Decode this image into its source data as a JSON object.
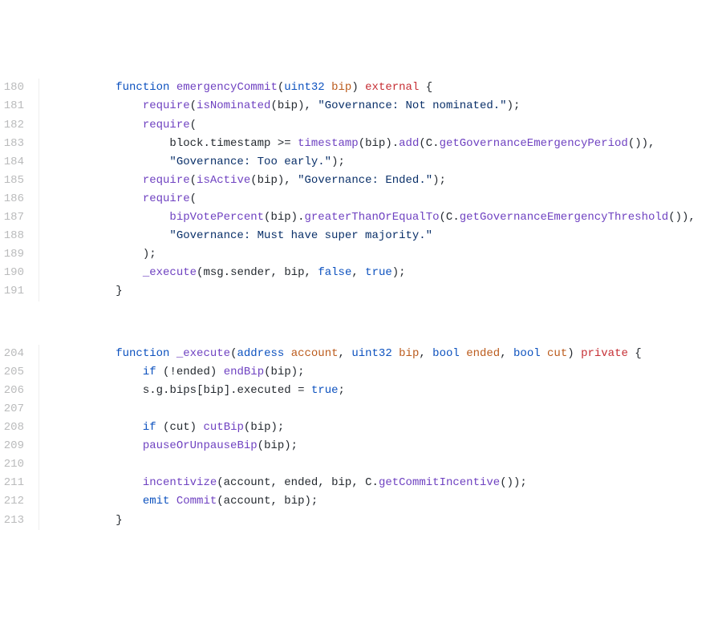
{
  "code": {
    "block1": {
      "lines": [
        {
          "n": "180",
          "indent": 2,
          "tokens": [
            {
              "cls": "kw",
              "t": "function"
            },
            {
              "cls": "plain",
              "t": " "
            },
            {
              "cls": "fn",
              "t": "emergencyCommit"
            },
            {
              "cls": "punct",
              "t": "("
            },
            {
              "cls": "type",
              "t": "uint32"
            },
            {
              "cls": "plain",
              "t": " "
            },
            {
              "cls": "param",
              "t": "bip"
            },
            {
              "cls": "punct",
              "t": ")"
            },
            {
              "cls": "plain",
              "t": " "
            },
            {
              "cls": "mod",
              "t": "external"
            },
            {
              "cls": "plain",
              "t": " "
            },
            {
              "cls": "punct",
              "t": "{"
            }
          ]
        },
        {
          "n": "181",
          "indent": 3,
          "tokens": [
            {
              "cls": "fn",
              "t": "require"
            },
            {
              "cls": "punct",
              "t": "("
            },
            {
              "cls": "fn",
              "t": "isNominated"
            },
            {
              "cls": "punct",
              "t": "("
            },
            {
              "cls": "plain",
              "t": "bip"
            },
            {
              "cls": "punct",
              "t": "), "
            },
            {
              "cls": "str",
              "t": "\"Governance: Not nominated.\""
            },
            {
              "cls": "punct",
              "t": ");"
            }
          ]
        },
        {
          "n": "182",
          "indent": 3,
          "tokens": [
            {
              "cls": "fn",
              "t": "require"
            },
            {
              "cls": "punct",
              "t": "("
            }
          ]
        },
        {
          "n": "183",
          "indent": 4,
          "tokens": [
            {
              "cls": "plain",
              "t": "block"
            },
            {
              "cls": "punct",
              "t": "."
            },
            {
              "cls": "plain",
              "t": "timestamp "
            },
            {
              "cls": "punct",
              "t": ">="
            },
            {
              "cls": "plain",
              "t": " "
            },
            {
              "cls": "fn",
              "t": "timestamp"
            },
            {
              "cls": "punct",
              "t": "("
            },
            {
              "cls": "plain",
              "t": "bip"
            },
            {
              "cls": "punct",
              "t": ")."
            },
            {
              "cls": "fn",
              "t": "add"
            },
            {
              "cls": "punct",
              "t": "("
            },
            {
              "cls": "plain",
              "t": "C"
            },
            {
              "cls": "punct",
              "t": "."
            },
            {
              "cls": "fn",
              "t": "getGovernanceEmergencyPeriod"
            },
            {
              "cls": "punct",
              "t": "()),"
            }
          ]
        },
        {
          "n": "184",
          "indent": 4,
          "tokens": [
            {
              "cls": "str",
              "t": "\"Governance: Too early.\""
            },
            {
              "cls": "punct",
              "t": ");"
            }
          ]
        },
        {
          "n": "185",
          "indent": 3,
          "tokens": [
            {
              "cls": "fn",
              "t": "require"
            },
            {
              "cls": "punct",
              "t": "("
            },
            {
              "cls": "fn",
              "t": "isActive"
            },
            {
              "cls": "punct",
              "t": "("
            },
            {
              "cls": "plain",
              "t": "bip"
            },
            {
              "cls": "punct",
              "t": "), "
            },
            {
              "cls": "str",
              "t": "\"Governance: Ended.\""
            },
            {
              "cls": "punct",
              "t": ");"
            }
          ]
        },
        {
          "n": "186",
          "indent": 3,
          "tokens": [
            {
              "cls": "fn",
              "t": "require"
            },
            {
              "cls": "punct",
              "t": "("
            }
          ]
        },
        {
          "n": "187",
          "indent": 4,
          "tokens": [
            {
              "cls": "fn",
              "t": "bipVotePercent"
            },
            {
              "cls": "punct",
              "t": "("
            },
            {
              "cls": "plain",
              "t": "bip"
            },
            {
              "cls": "punct",
              "t": ")."
            },
            {
              "cls": "fn",
              "t": "greaterThanOrEqualTo"
            },
            {
              "cls": "punct",
              "t": "("
            },
            {
              "cls": "plain",
              "t": "C"
            },
            {
              "cls": "punct",
              "t": "."
            },
            {
              "cls": "fn",
              "t": "getGovernanceEmergencyThreshold"
            },
            {
              "cls": "punct",
              "t": "()),"
            }
          ]
        },
        {
          "n": "188",
          "indent": 4,
          "tokens": [
            {
              "cls": "str",
              "t": "\"Governance: Must have super majority.\""
            }
          ]
        },
        {
          "n": "189",
          "indent": 3,
          "tokens": [
            {
              "cls": "punct",
              "t": ");"
            }
          ]
        },
        {
          "n": "190",
          "indent": 3,
          "tokens": [
            {
              "cls": "fn",
              "t": "_execute"
            },
            {
              "cls": "punct",
              "t": "("
            },
            {
              "cls": "plain",
              "t": "msg"
            },
            {
              "cls": "punct",
              "t": "."
            },
            {
              "cls": "plain",
              "t": "sender"
            },
            {
              "cls": "punct",
              "t": ", "
            },
            {
              "cls": "plain",
              "t": "bip"
            },
            {
              "cls": "punct",
              "t": ", "
            },
            {
              "cls": "bool",
              "t": "false"
            },
            {
              "cls": "punct",
              "t": ", "
            },
            {
              "cls": "bool",
              "t": "true"
            },
            {
              "cls": "punct",
              "t": ");"
            }
          ]
        },
        {
          "n": "191",
          "indent": 2,
          "tokens": [
            {
              "cls": "punct",
              "t": "}"
            }
          ]
        }
      ]
    },
    "block2": {
      "lines": [
        {
          "n": "204",
          "indent": 2,
          "tokens": [
            {
              "cls": "kw",
              "t": "function"
            },
            {
              "cls": "plain",
              "t": " "
            },
            {
              "cls": "fn",
              "t": "_execute"
            },
            {
              "cls": "punct",
              "t": "("
            },
            {
              "cls": "type",
              "t": "address"
            },
            {
              "cls": "plain",
              "t": " "
            },
            {
              "cls": "param",
              "t": "account"
            },
            {
              "cls": "punct",
              "t": ", "
            },
            {
              "cls": "type",
              "t": "uint32"
            },
            {
              "cls": "plain",
              "t": " "
            },
            {
              "cls": "param",
              "t": "bip"
            },
            {
              "cls": "punct",
              "t": ", "
            },
            {
              "cls": "type",
              "t": "bool"
            },
            {
              "cls": "plain",
              "t": " "
            },
            {
              "cls": "param",
              "t": "ended"
            },
            {
              "cls": "punct",
              "t": ", "
            },
            {
              "cls": "type",
              "t": "bool"
            },
            {
              "cls": "plain",
              "t": " "
            },
            {
              "cls": "param",
              "t": "cut"
            },
            {
              "cls": "punct",
              "t": ")"
            },
            {
              "cls": "plain",
              "t": " "
            },
            {
              "cls": "mod",
              "t": "private"
            },
            {
              "cls": "plain",
              "t": " "
            },
            {
              "cls": "punct",
              "t": "{"
            }
          ]
        },
        {
          "n": "205",
          "indent": 3,
          "tokens": [
            {
              "cls": "kw",
              "t": "if"
            },
            {
              "cls": "plain",
              "t": " "
            },
            {
              "cls": "punct",
              "t": "(!"
            },
            {
              "cls": "plain",
              "t": "ended"
            },
            {
              "cls": "punct",
              "t": ") "
            },
            {
              "cls": "fn",
              "t": "endBip"
            },
            {
              "cls": "punct",
              "t": "("
            },
            {
              "cls": "plain",
              "t": "bip"
            },
            {
              "cls": "punct",
              "t": ");"
            }
          ]
        },
        {
          "n": "206",
          "indent": 3,
          "tokens": [
            {
              "cls": "plain",
              "t": "s"
            },
            {
              "cls": "punct",
              "t": "."
            },
            {
              "cls": "plain",
              "t": "g"
            },
            {
              "cls": "punct",
              "t": "."
            },
            {
              "cls": "plain",
              "t": "bips"
            },
            {
              "cls": "punct",
              "t": "["
            },
            {
              "cls": "plain",
              "t": "bip"
            },
            {
              "cls": "punct",
              "t": "]."
            },
            {
              "cls": "plain",
              "t": "executed"
            },
            {
              "cls": "plain",
              "t": " "
            },
            {
              "cls": "punct",
              "t": "="
            },
            {
              "cls": "plain",
              "t": " "
            },
            {
              "cls": "bool",
              "t": "true"
            },
            {
              "cls": "punct",
              "t": ";"
            }
          ]
        },
        {
          "n": "207",
          "indent": 0,
          "tokens": []
        },
        {
          "n": "208",
          "indent": 3,
          "tokens": [
            {
              "cls": "kw",
              "t": "if"
            },
            {
              "cls": "plain",
              "t": " "
            },
            {
              "cls": "punct",
              "t": "("
            },
            {
              "cls": "plain",
              "t": "cut"
            },
            {
              "cls": "punct",
              "t": ") "
            },
            {
              "cls": "fn",
              "t": "cutBip"
            },
            {
              "cls": "punct",
              "t": "("
            },
            {
              "cls": "plain",
              "t": "bip"
            },
            {
              "cls": "punct",
              "t": ");"
            }
          ]
        },
        {
          "n": "209",
          "indent": 3,
          "tokens": [
            {
              "cls": "fn",
              "t": "pauseOrUnpauseBip"
            },
            {
              "cls": "punct",
              "t": "("
            },
            {
              "cls": "plain",
              "t": "bip"
            },
            {
              "cls": "punct",
              "t": ");"
            }
          ]
        },
        {
          "n": "210",
          "indent": 0,
          "tokens": []
        },
        {
          "n": "211",
          "indent": 3,
          "tokens": [
            {
              "cls": "fn",
              "t": "incentivize"
            },
            {
              "cls": "punct",
              "t": "("
            },
            {
              "cls": "plain",
              "t": "account"
            },
            {
              "cls": "punct",
              "t": ", "
            },
            {
              "cls": "plain",
              "t": "ended"
            },
            {
              "cls": "punct",
              "t": ", "
            },
            {
              "cls": "plain",
              "t": "bip"
            },
            {
              "cls": "punct",
              "t": ", "
            },
            {
              "cls": "plain",
              "t": "C"
            },
            {
              "cls": "punct",
              "t": "."
            },
            {
              "cls": "fn",
              "t": "getCommitIncentive"
            },
            {
              "cls": "punct",
              "t": "());"
            }
          ]
        },
        {
          "n": "212",
          "indent": 3,
          "tokens": [
            {
              "cls": "kw",
              "t": "emit"
            },
            {
              "cls": "plain",
              "t": " "
            },
            {
              "cls": "fn",
              "t": "Commit"
            },
            {
              "cls": "punct",
              "t": "("
            },
            {
              "cls": "plain",
              "t": "account"
            },
            {
              "cls": "punct",
              "t": ", "
            },
            {
              "cls": "plain",
              "t": "bip"
            },
            {
              "cls": "punct",
              "t": ");"
            }
          ]
        },
        {
          "n": "213",
          "indent": 2,
          "tokens": [
            {
              "cls": "punct",
              "t": "}"
            }
          ]
        }
      ]
    }
  }
}
